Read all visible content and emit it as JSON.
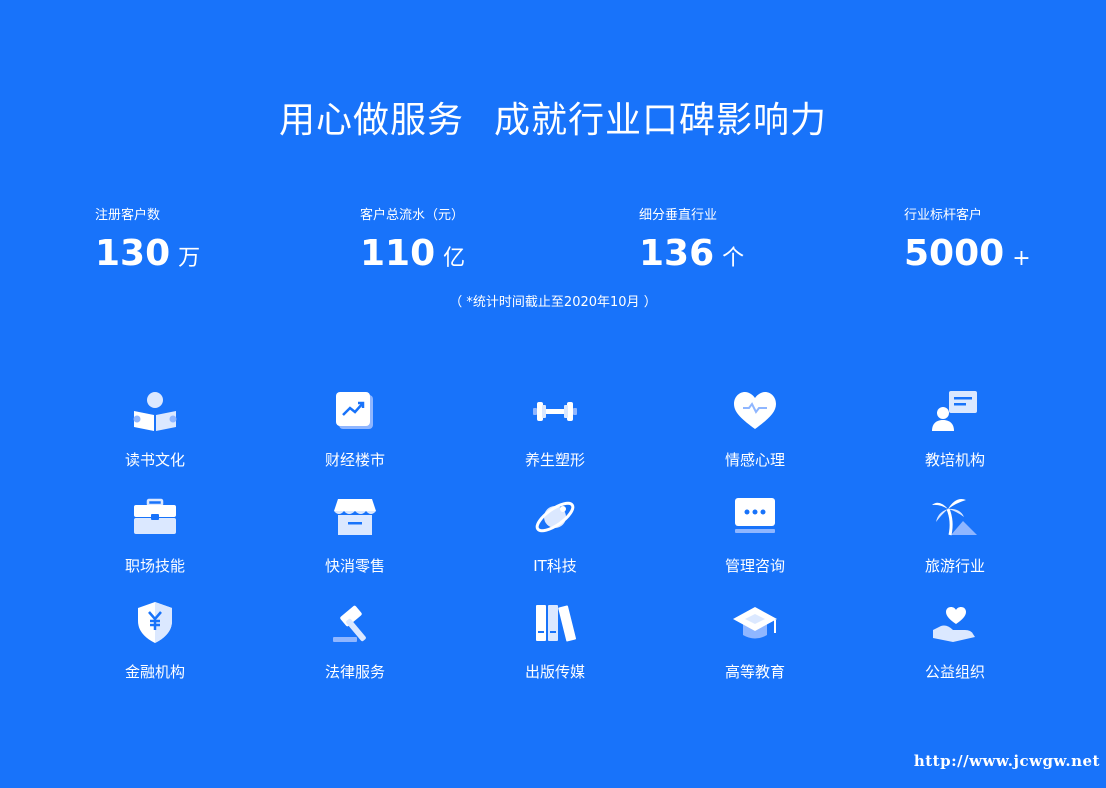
{
  "headline": {
    "part1": "用心做服务",
    "part2": "成就行业口碑影响力"
  },
  "stats": [
    {
      "label": "注册客户数",
      "number": "130",
      "unit": "万"
    },
    {
      "label": "客户总流水（元）",
      "number": "110",
      "unit": "亿"
    },
    {
      "label": "细分垂直行业",
      "number": "136",
      "unit": "个"
    },
    {
      "label": "行业标杆客户",
      "number": "5000",
      "unit": "+"
    }
  ],
  "footnote": "（  *统计时间截止至2020年10月  ）",
  "industries": [
    {
      "label": "读书文化",
      "icon": "reading-icon"
    },
    {
      "label": "财经楼市",
      "icon": "finance-chart-icon"
    },
    {
      "label": "养生塑形",
      "icon": "dumbbell-icon"
    },
    {
      "label": "情感心理",
      "icon": "heart-icon"
    },
    {
      "label": "教培机构",
      "icon": "teacher-board-icon"
    },
    {
      "label": "职场技能",
      "icon": "briefcase-icon"
    },
    {
      "label": "快消零售",
      "icon": "store-icon"
    },
    {
      "label": "IT科技",
      "icon": "planet-icon"
    },
    {
      "label": "管理咨询",
      "icon": "chat-screen-icon"
    },
    {
      "label": "旅游行业",
      "icon": "palm-tree-icon"
    },
    {
      "label": "金融机构",
      "icon": "yuan-shield-icon"
    },
    {
      "label": "法律服务",
      "icon": "gavel-icon"
    },
    {
      "label": "出版传媒",
      "icon": "books-icon"
    },
    {
      "label": "高等教育",
      "icon": "graduation-cap-icon"
    },
    {
      "label": "公益组织",
      "icon": "heart-hand-icon"
    }
  ],
  "watermark": "http://www.jcwgw.net",
  "colors": {
    "background": "#1873fa",
    "icon_light": "#ffffff",
    "icon_mid": "#dbe8ff",
    "icon_shade": "#8fb6ff"
  }
}
